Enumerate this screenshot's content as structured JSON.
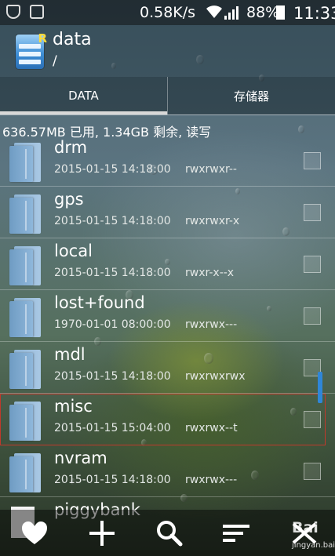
{
  "status_bar": {
    "net_speed": "0.58K/s",
    "battery_pct": "88%",
    "time": "11:33",
    "icons": [
      "shield-icon",
      "image-icon",
      "wifi-icon",
      "signal-icon",
      "battery-icon"
    ]
  },
  "header": {
    "title": "data",
    "path": "/",
    "app_icon": "root-explorer-icon"
  },
  "tabs": [
    {
      "label": "DATA",
      "active": true
    },
    {
      "label": "存储器",
      "active": false
    }
  ],
  "storage_info": "636.57MB 已用, 1.34GB 剩余, 读写",
  "files": [
    {
      "name": "drm",
      "date": "2015-01-15 14:18:00",
      "perms": "rwxrwxr--"
    },
    {
      "name": "gps",
      "date": "2015-01-15 14:18:00",
      "perms": "rwxrwxr-x"
    },
    {
      "name": "local",
      "date": "2015-01-15 14:18:00",
      "perms": "rwxr-x--x"
    },
    {
      "name": "lost+found",
      "date": "1970-01-01 08:00:00",
      "perms": "rwxrwx---"
    },
    {
      "name": "mdl",
      "date": "2015-01-15 14:18:00",
      "perms": "rwxrwxrwx"
    },
    {
      "name": "misc",
      "date": "2015-01-15 15:04:00",
      "perms": "rwxrwx--t",
      "selected": true
    },
    {
      "name": "nvram",
      "date": "2015-01-15 14:18:00",
      "perms": "rwxrwx---"
    },
    {
      "name": "piggybank",
      "date": "",
      "perms": ""
    }
  ],
  "toolbar": {
    "icons": [
      "favorite-heart-icon",
      "add-plus-icon",
      "search-icon",
      "sort-icon",
      "multi-select-icon"
    ]
  },
  "watermark": {
    "brand": "Bai",
    "sub": "jingyan.baidu"
  },
  "colors": {
    "accent_blue": "#2f86d8",
    "selection_red": "#c0392b"
  }
}
